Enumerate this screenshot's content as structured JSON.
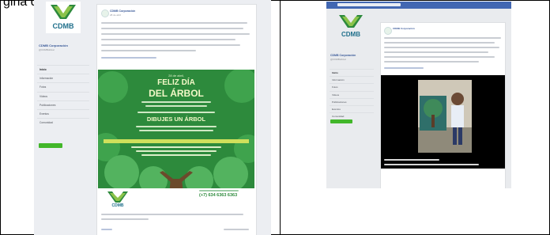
{
  "caption": "gina de Facebook",
  "page": {
    "logo_text": "CDMB",
    "name": "CDMB Corporación",
    "handle": "@CDMBoficial"
  },
  "nav": [
    "Inicio",
    "Información",
    "Fotos",
    "Videos",
    "Publicaciones",
    "Eventos",
    "Comunidad",
    "Crear una página"
  ],
  "post": {
    "author": "CDMB Corporación",
    "date": "28 de abril"
  },
  "poster": {
    "date_line": "28 de abril,",
    "title_1": "FELIZ DÍA",
    "title_2": "DEL ÁRBOL",
    "subtitle": "DIBUJES UN ÁRBOL",
    "phone": "(+7) 634 6363 6363"
  },
  "colors": {
    "facebook_blue": "#4267b2",
    "poster_green": "#2d8a3c",
    "like_green": "#42b72a",
    "link_blue": "#385898"
  }
}
